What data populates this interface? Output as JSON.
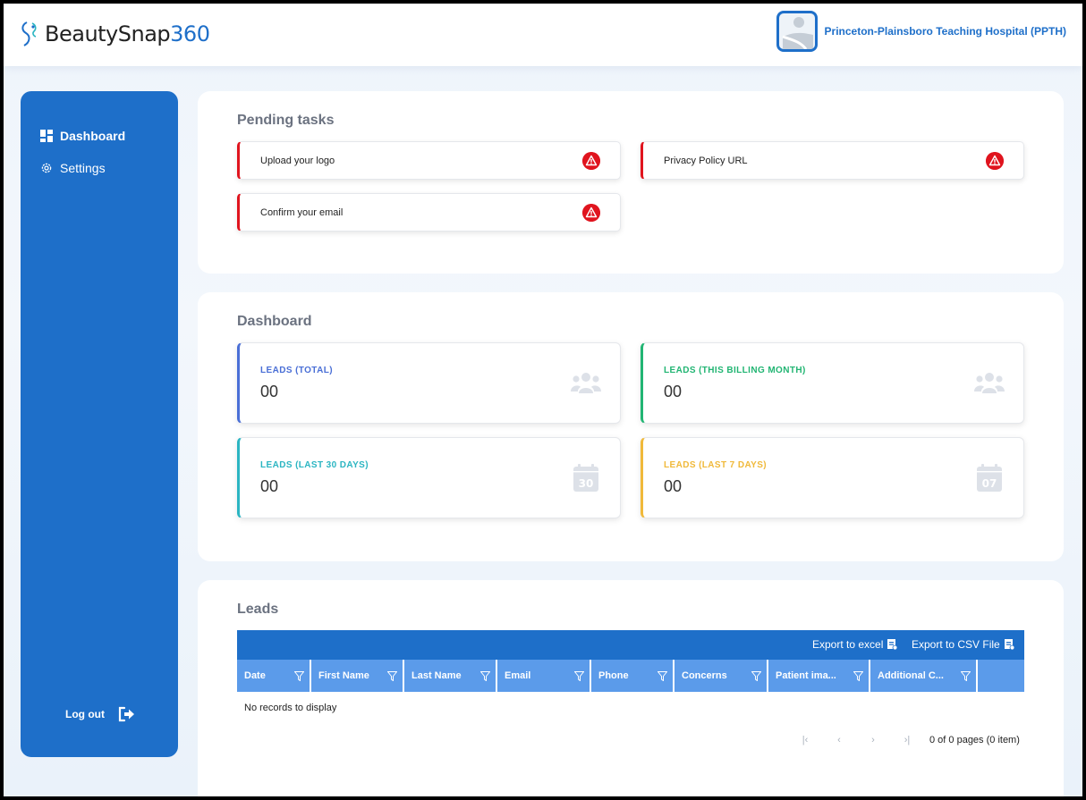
{
  "brand": {
    "name": "BeautySnap",
    "name_suffix": "360",
    "accent": "#1e6fc9"
  },
  "header": {
    "organization": "Princeton-Plainsboro Teaching Hospital (PPTH)"
  },
  "sidebar": {
    "items": [
      {
        "label": "Dashboard",
        "icon": "dashboard-icon",
        "active": true
      },
      {
        "label": "Settings",
        "icon": "gear-icon",
        "active": false
      }
    ],
    "logout_label": "Log out"
  },
  "pending": {
    "title": "Pending tasks",
    "tasks": [
      {
        "label": "Upload your logo"
      },
      {
        "label": "Privacy Policy URL"
      },
      {
        "label": "Confirm your email"
      }
    ]
  },
  "dashboard": {
    "title": "Dashboard",
    "stats": [
      {
        "label": "LEADS (TOTAL)",
        "value": "00",
        "color": "#4a6fd6",
        "icon": "users-icon"
      },
      {
        "label": "LEADS (THIS BILLING MONTH)",
        "value": "00",
        "color": "#22b573",
        "icon": "users-icon"
      },
      {
        "label": "LEADS (LAST 30 DAYS)",
        "value": "00",
        "color": "#2bb5c2",
        "icon": "calendar-icon",
        "icon_text": "30"
      },
      {
        "label": "LEADS (LAST 7 DAYS)",
        "value": "00",
        "color": "#f0b93a",
        "icon": "calendar-icon",
        "icon_text": "07"
      }
    ]
  },
  "leads": {
    "title": "Leads",
    "export_excel": "Export to excel",
    "export_csv": "Export to CSV File",
    "columns": [
      "Date",
      "First Name",
      "Last Name",
      "Email",
      "Phone",
      "Concerns",
      "Patient ima...",
      "Additional C..."
    ],
    "empty_text": "No records to display",
    "pager_info": "0 of 0 pages (0 item)"
  }
}
